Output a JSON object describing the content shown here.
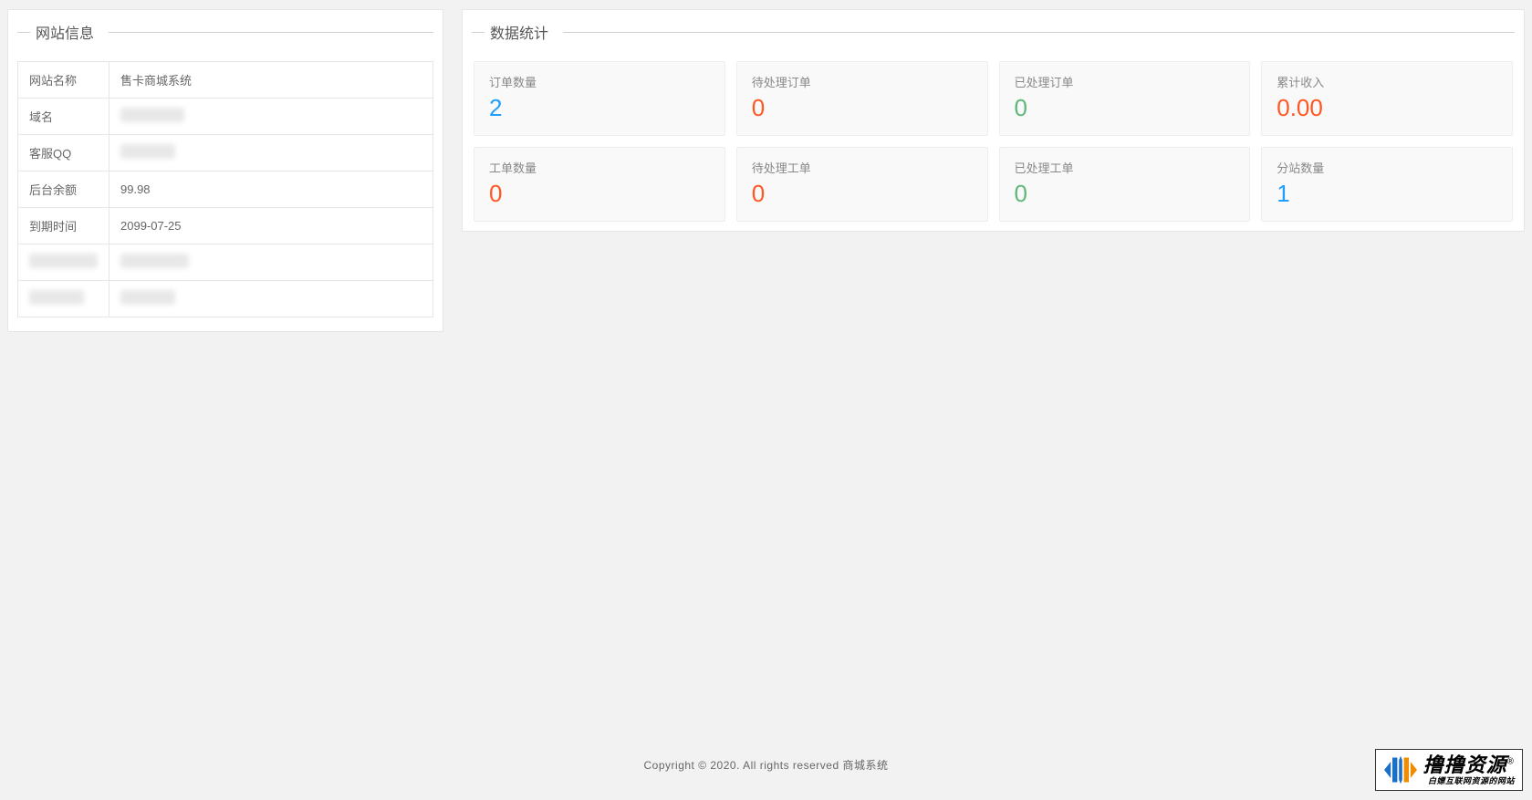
{
  "site_info": {
    "panel_title": "网站信息",
    "rows": [
      {
        "label": "网站名称",
        "value": "售卡商城系统",
        "blurred": false
      },
      {
        "label": "域名",
        "value": "",
        "blurred": true,
        "blur_class": "blur-sm"
      },
      {
        "label": "客服QQ",
        "value": "",
        "blurred": true,
        "blur_class": "blur-md"
      },
      {
        "label": "后台余额",
        "value": "99.98",
        "blurred": false
      },
      {
        "label": "到期时间",
        "value": "2099-07-25",
        "blurred": false
      },
      {
        "label": "",
        "value": "",
        "blurred": true,
        "label_blurred": true,
        "label_blur_class": "blur-lg",
        "blur_class": "blur-lg"
      },
      {
        "label": "",
        "value": "",
        "blurred": true,
        "label_blurred": true,
        "label_blur_class": "blur-md",
        "blur_class": "blur-md"
      }
    ]
  },
  "stats": {
    "panel_title": "数据统计",
    "cards": [
      {
        "label": "订单数量",
        "value": "2",
        "color": "c-blue"
      },
      {
        "label": "待处理订单",
        "value": "0",
        "color": "c-red"
      },
      {
        "label": "已处理订单",
        "value": "0",
        "color": "c-green"
      },
      {
        "label": "累计收入",
        "value": "0.00",
        "color": "c-red"
      },
      {
        "label": "工单数量",
        "value": "0",
        "color": "c-red"
      },
      {
        "label": "待处理工单",
        "value": "0",
        "color": "c-red"
      },
      {
        "label": "已处理工单",
        "value": "0",
        "color": "c-green"
      },
      {
        "label": "分站数量",
        "value": "1",
        "color": "c-blue"
      }
    ]
  },
  "footer": {
    "text": "Copyright © 2020. All rights reserved 商城系统"
  },
  "watermark": {
    "main": "撸撸资源",
    "reg": "®",
    "sub": "白嫖互联网资源的网站"
  }
}
